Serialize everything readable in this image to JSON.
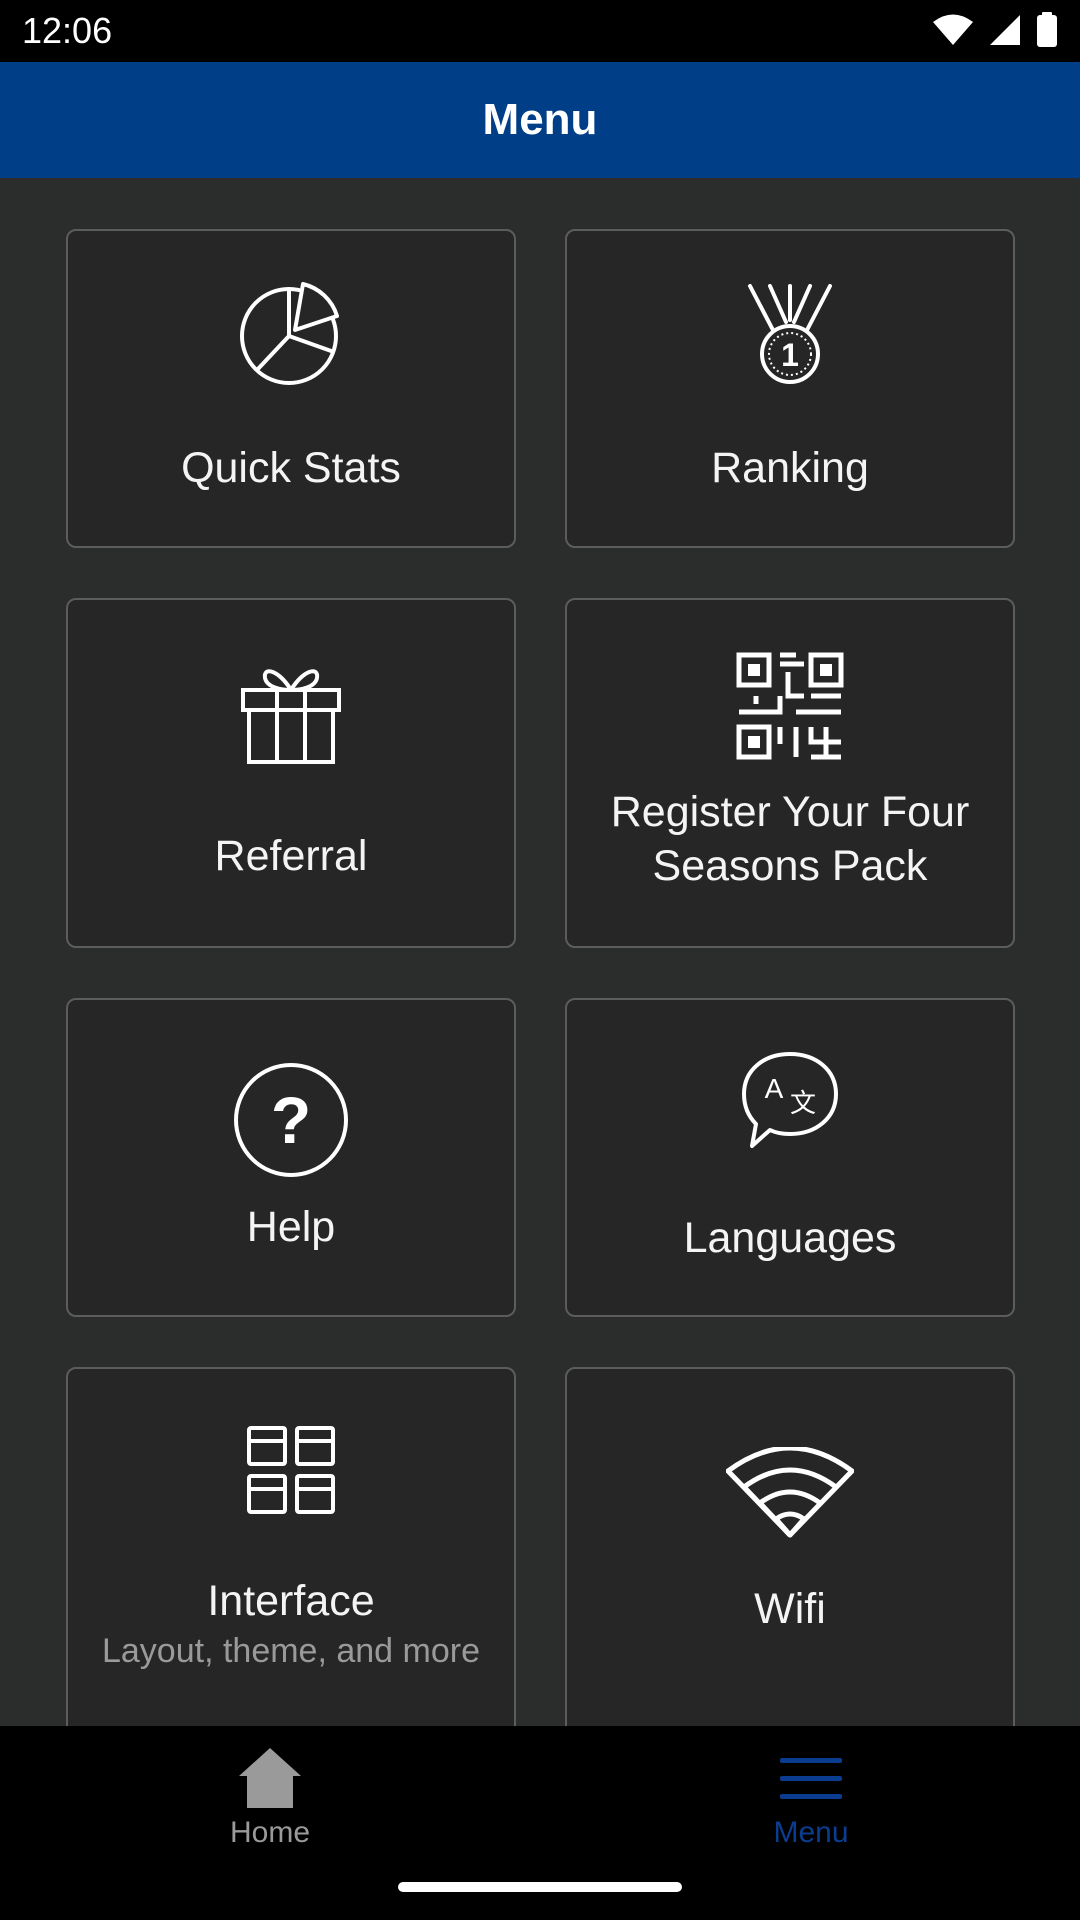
{
  "status_bar": {
    "time": "12:06",
    "icons": [
      "wifi-icon",
      "signal-icon",
      "battery-icon"
    ]
  },
  "app_bar": {
    "title": "Menu",
    "color": "#003f87"
  },
  "menu": {
    "items": [
      {
        "label": "Quick Stats",
        "icon": "pie-chart-icon"
      },
      {
        "label": "Ranking",
        "icon": "medal-icon"
      },
      {
        "label": "Referral",
        "icon": "gift-icon"
      },
      {
        "label": "Register Your Four Seasons Pack",
        "icon": "qr-code-icon"
      },
      {
        "label": "Help",
        "icon": "help-circle-icon"
      },
      {
        "label": "Languages",
        "icon": "translate-icon"
      },
      {
        "label": "Interface",
        "sublabel": "Layout, theme, and more",
        "icon": "layout-grid-icon"
      },
      {
        "label": "Wifi",
        "icon": "wifi-icon"
      }
    ]
  },
  "bottom_nav": {
    "items": [
      {
        "label": "Home",
        "icon": "home-icon",
        "active": false
      },
      {
        "label": "Menu",
        "icon": "hamburger-menu-icon",
        "active": true
      }
    ],
    "active_color": "#0a3d8f",
    "inactive_color": "#9a9a9a"
  }
}
